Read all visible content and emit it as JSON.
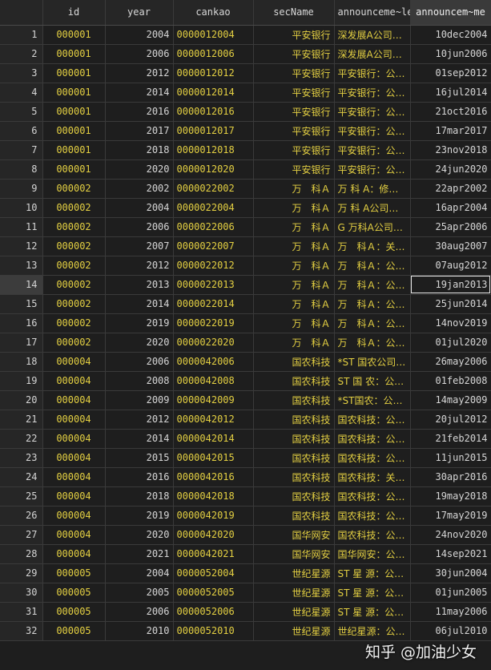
{
  "columns": [
    "id",
    "year",
    "cankao",
    "secName",
    "announceme~le",
    "announcem~me"
  ],
  "rows": [
    {
      "n": "1",
      "id": "000001",
      "year": "2004",
      "cankao": "0000012004",
      "sec": "平安银行",
      "ann": "深发展A公司…",
      "date": "10dec2004"
    },
    {
      "n": "2",
      "id": "000001",
      "year": "2006",
      "cankao": "0000012006",
      "sec": "平安银行",
      "ann": "深发展A公司…",
      "date": "10jun2006"
    },
    {
      "n": "3",
      "id": "000001",
      "year": "2012",
      "cankao": "0000012012",
      "sec": "平安银行",
      "ann": "平安银行：公…",
      "date": "01sep2012"
    },
    {
      "n": "4",
      "id": "000001",
      "year": "2014",
      "cankao": "0000012014",
      "sec": "平安银行",
      "ann": "平安银行：公…",
      "date": "16jul2014"
    },
    {
      "n": "5",
      "id": "000001",
      "year": "2016",
      "cankao": "0000012016",
      "sec": "平安银行",
      "ann": "平安银行：公…",
      "date": "21oct2016"
    },
    {
      "n": "6",
      "id": "000001",
      "year": "2017",
      "cankao": "0000012017",
      "sec": "平安银行",
      "ann": "平安银行：公…",
      "date": "17mar2017"
    },
    {
      "n": "7",
      "id": "000001",
      "year": "2018",
      "cankao": "0000012018",
      "sec": "平安银行",
      "ann": "平安银行：公…",
      "date": "23nov2018"
    },
    {
      "n": "8",
      "id": "000001",
      "year": "2020",
      "cankao": "0000012020",
      "sec": "平安银行",
      "ann": "平安银行：公…",
      "date": "24jun2020"
    },
    {
      "n": "9",
      "id": "000002",
      "year": "2002",
      "cankao": "0000022002",
      "sec": "万　科Ａ",
      "ann": "万 科 A：修…",
      "date": "22apr2002"
    },
    {
      "n": "10",
      "id": "000002",
      "year": "2004",
      "cankao": "0000022004",
      "sec": "万　科Ａ",
      "ann": "万 科 A公司…",
      "date": "16apr2004"
    },
    {
      "n": "11",
      "id": "000002",
      "year": "2006",
      "cankao": "0000022006",
      "sec": "万　科Ａ",
      "ann": "G 万科A公司…",
      "date": "25apr2006"
    },
    {
      "n": "12",
      "id": "000002",
      "year": "2007",
      "cankao": "0000022007",
      "sec": "万　科Ａ",
      "ann": "万　科Ａ：关…",
      "date": "30aug2007"
    },
    {
      "n": "13",
      "id": "000002",
      "year": "2012",
      "cankao": "0000022012",
      "sec": "万　科Ａ",
      "ann": "万　科Ａ：公…",
      "date": "07aug2012"
    },
    {
      "n": "14",
      "id": "000002",
      "year": "2013",
      "cankao": "0000022013",
      "sec": "万　科Ａ",
      "ann": "万　科Ａ：公…",
      "date": "19jan2013"
    },
    {
      "n": "15",
      "id": "000002",
      "year": "2014",
      "cankao": "0000022014",
      "sec": "万　科Ａ",
      "ann": "万　科Ａ：公…",
      "date": "25jun2014"
    },
    {
      "n": "16",
      "id": "000002",
      "year": "2019",
      "cankao": "0000022019",
      "sec": "万　科Ａ",
      "ann": "万　科Ａ：公…",
      "date": "14nov2019"
    },
    {
      "n": "17",
      "id": "000002",
      "year": "2020",
      "cankao": "0000022020",
      "sec": "万　科Ａ",
      "ann": "万　科Ａ：公…",
      "date": "01jul2020"
    },
    {
      "n": "18",
      "id": "000004",
      "year": "2006",
      "cankao": "0000042006",
      "sec": "国农科技",
      "ann": "*ST 国农公司…",
      "date": "26may2006"
    },
    {
      "n": "19",
      "id": "000004",
      "year": "2008",
      "cankao": "0000042008",
      "sec": "国农科技",
      "ann": "ST 国 农：公…",
      "date": "01feb2008"
    },
    {
      "n": "20",
      "id": "000004",
      "year": "2009",
      "cankao": "0000042009",
      "sec": "国农科技",
      "ann": "*ST国农：公…",
      "date": "14may2009"
    },
    {
      "n": "21",
      "id": "000004",
      "year": "2012",
      "cankao": "0000042012",
      "sec": "国农科技",
      "ann": "国农科技：公…",
      "date": "20jul2012"
    },
    {
      "n": "22",
      "id": "000004",
      "year": "2014",
      "cankao": "0000042014",
      "sec": "国农科技",
      "ann": "国农科技：公…",
      "date": "21feb2014"
    },
    {
      "n": "23",
      "id": "000004",
      "year": "2015",
      "cankao": "0000042015",
      "sec": "国农科技",
      "ann": "国农科技：公…",
      "date": "11jun2015"
    },
    {
      "n": "24",
      "id": "000004",
      "year": "2016",
      "cankao": "0000042016",
      "sec": "国农科技",
      "ann": "国农科技：关…",
      "date": "30apr2016"
    },
    {
      "n": "25",
      "id": "000004",
      "year": "2018",
      "cankao": "0000042018",
      "sec": "国农科技",
      "ann": "国农科技：公…",
      "date": "19may2018"
    },
    {
      "n": "26",
      "id": "000004",
      "year": "2019",
      "cankao": "0000042019",
      "sec": "国农科技",
      "ann": "国农科技：公…",
      "date": "17may2019"
    },
    {
      "n": "27",
      "id": "000004",
      "year": "2020",
      "cankao": "0000042020",
      "sec": "国华网安",
      "ann": "国农科技：公…",
      "date": "24nov2020"
    },
    {
      "n": "28",
      "id": "000004",
      "year": "2021",
      "cankao": "0000042021",
      "sec": "国华网安",
      "ann": "国华网安：公…",
      "date": "14sep2021"
    },
    {
      "n": "29",
      "id": "000005",
      "year": "2004",
      "cankao": "0000052004",
      "sec": "世纪星源",
      "ann": "ST 星 源：公…",
      "date": "30jun2004"
    },
    {
      "n": "30",
      "id": "000005",
      "year": "2005",
      "cankao": "0000052005",
      "sec": "世纪星源",
      "ann": "ST 星 源：公…",
      "date": "01jun2005"
    },
    {
      "n": "31",
      "id": "000005",
      "year": "2006",
      "cankao": "0000052006",
      "sec": "世纪星源",
      "ann": "ST 星 源：公…",
      "date": "11may2006"
    },
    {
      "n": "32",
      "id": "000005",
      "year": "2010",
      "cankao": "0000052010",
      "sec": "世纪星源",
      "ann": "世纪星源：公…",
      "date": "06jul2010"
    }
  ],
  "selected_row": 14,
  "watermark": "知乎 @加油少女",
  "colors": {
    "value": "#e3cf42",
    "numeric": "#d6d6d6",
    "background": "#1e1e1e",
    "grid": "#3a3a3a"
  }
}
